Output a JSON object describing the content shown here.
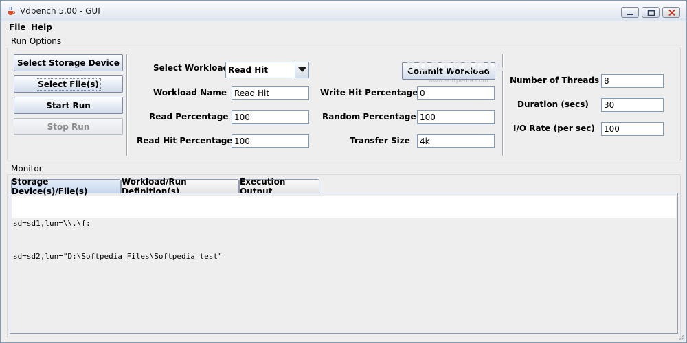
{
  "window": {
    "title": "Vdbench 5.00 - GUI"
  },
  "menu": {
    "file_first": "F",
    "file_rest": "ile",
    "help_first": "H",
    "help_rest": "elp"
  },
  "run_options": {
    "title": "Run Options",
    "buttons": {
      "select_storage": "Select Storage Device",
      "select_files": "Select File(s)",
      "start_run": "Start Run",
      "stop_run": "Stop Run",
      "commit_workload": "Commit Workload"
    },
    "workload": {
      "select_label": "Select Workload",
      "selected": "Read Hit",
      "name_label": "Workload Name",
      "name_value": "Read Hit",
      "read_pct_label": "Read Percentage",
      "read_pct_value": "100",
      "read_hit_label": "Read Hit Percentage",
      "read_hit_value": "100",
      "write_hit_label": "Write Hit Percentage",
      "write_hit_value": "0",
      "random_pct_label": "Random Percentage",
      "random_pct_value": "100",
      "transfer_label": "Transfer Size",
      "transfer_value": "4k"
    },
    "run_params": {
      "threads_label": "Number of Threads",
      "threads_value": "8",
      "duration_label": "Duration (secs)",
      "duration_value": "30",
      "io_rate_label": "I/O Rate (per sec)",
      "io_rate_value": "100"
    }
  },
  "monitor": {
    "title": "Monitor",
    "tabs": [
      {
        "label": "Storage Device(s)/File(s)"
      },
      {
        "label": "Workload/Run Definition(s)"
      },
      {
        "label": "Execution Output"
      }
    ],
    "lines": [
      "sd=sd1,lun=\\\\.\\f:",
      "sd=sd2,lun=\"D:\\Softpedia Files\\Softpedia test\""
    ]
  },
  "watermark": {
    "main": "SOFTPEDIA",
    "sub": "www.softpedia.com"
  },
  "colors": {
    "accent": "#c6d6ec",
    "border": "#7f9db9",
    "background": "#eeeeee"
  }
}
